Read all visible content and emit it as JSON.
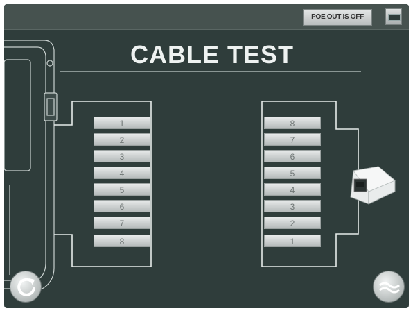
{
  "header": {
    "poe_button_label": "POE OUT IS OFF"
  },
  "main": {
    "title": "CABLE TEST",
    "left_pins": [
      "1",
      "2",
      "3",
      "4",
      "5",
      "6",
      "7",
      "8"
    ],
    "right_pins": [
      "8",
      "7",
      "6",
      "5",
      "4",
      "3",
      "2",
      "1"
    ]
  },
  "icons": {
    "battery": "battery-icon",
    "refresh": "refresh-icon",
    "wave": "wave-icon",
    "tester_device": "tester-device-icon",
    "rj45_jack": "rj45-jack-icon"
  },
  "colors": {
    "screen_background": "#2f3d3b",
    "topbar": "#46524f",
    "pin_fill": "#d4d8d8",
    "outline": "#e6ecea"
  }
}
